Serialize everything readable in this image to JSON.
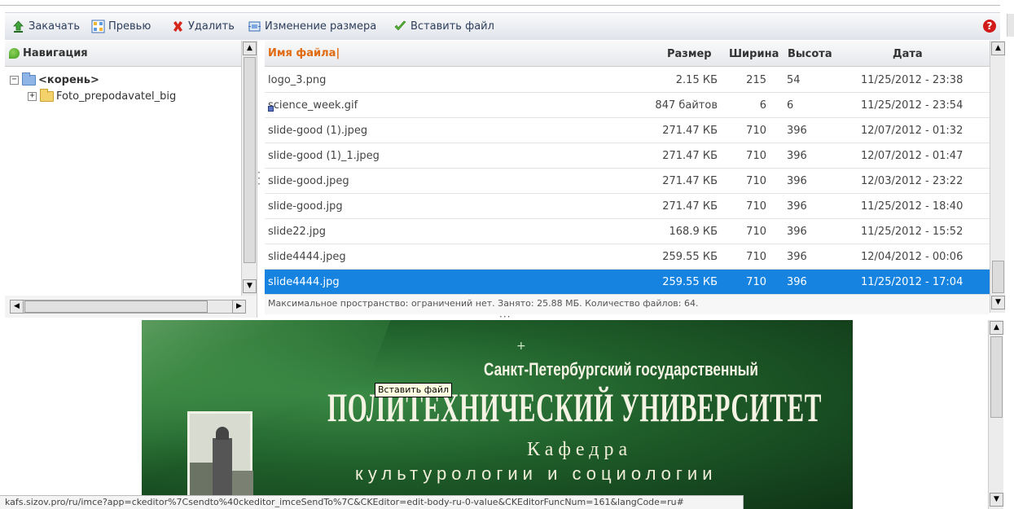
{
  "toolbar": {
    "items": [
      {
        "label": "Закачать",
        "icon": "upload-icon"
      },
      {
        "label": "Превью",
        "icon": "thumbnail-grid-icon"
      },
      {
        "label": "Удалить",
        "icon": "delete-x-icon"
      },
      {
        "label": "Изменение размера",
        "icon": "resize-icon"
      },
      {
        "label": "Вставить файл",
        "icon": "checkmark-icon"
      }
    ],
    "help_label": "?"
  },
  "navigation": {
    "title": "Навигация",
    "tree": [
      {
        "label": "<корень>",
        "expander": "−",
        "open": true
      },
      {
        "label": "Foto_prepodavatel_big",
        "expander": "+",
        "open": false
      }
    ]
  },
  "files": {
    "headers": {
      "name": "Имя файла",
      "size": "Размер",
      "width": "Ширина",
      "height": "Высота",
      "date": "Дата"
    },
    "rows": [
      {
        "name": "logo_3.png",
        "size": "2.15 КБ",
        "width": "215",
        "height": "54",
        "date": "11/25/2012 - 23:38"
      },
      {
        "name": "science_week.gif",
        "size": "847 байтов",
        "width": "6",
        "height": "6",
        "date": "11/25/2012 - 23:54"
      },
      {
        "name": "slide-good (1).jpeg",
        "size": "271.47 КБ",
        "width": "710",
        "height": "396",
        "date": "12/07/2012 - 01:32"
      },
      {
        "name": "slide-good (1)_1.jpeg",
        "size": "271.47 КБ",
        "width": "710",
        "height": "396",
        "date": "12/07/2012 - 01:47"
      },
      {
        "name": "slide-good.jpeg",
        "size": "271.47 КБ",
        "width": "710",
        "height": "396",
        "date": "12/03/2012 - 23:22"
      },
      {
        "name": "slide-good.jpg",
        "size": "271.47 КБ",
        "width": "710",
        "height": "396",
        "date": "11/25/2012 - 18:40"
      },
      {
        "name": "slide22.jpg",
        "size": "168.9 КБ",
        "width": "710",
        "height": "396",
        "date": "11/25/2012 - 15:52"
      },
      {
        "name": "slide4444.jpeg",
        "size": "259.55 КБ",
        "width": "710",
        "height": "396",
        "date": "12/04/2012 - 00:06"
      },
      {
        "name": "slide4444.jpg",
        "size": "259.55 КБ",
        "width": "710",
        "height": "396",
        "date": "11/25/2012 - 17:04",
        "selected": true
      }
    ],
    "status": "Максимальное пространство: ограничений нет. Занято: 25.88 МБ. Количество файлов: 64."
  },
  "preview": {
    "line1": "Санкт-Петербургский государственный",
    "line2": "ПОЛИТЕХНИЧЕСКИЙ УНИВЕРСИТЕТ",
    "line3": "Кафедра",
    "line4": "культурологии и социологии",
    "tooltip": "Вставить файл"
  },
  "statusbar": {
    "url": "kafs.sizov.pro/ru/imce?app=ckeditor%7Csendto%40ckeditor_imceSendTo%7C&CKEditor=edit-body-ru-0-value&CKEditorFuncNum=161&langCode=ru#"
  },
  "colors": {
    "accent": "#1683e0",
    "header_sort": "#e06a10",
    "banner_green": "#1f5e2a"
  }
}
